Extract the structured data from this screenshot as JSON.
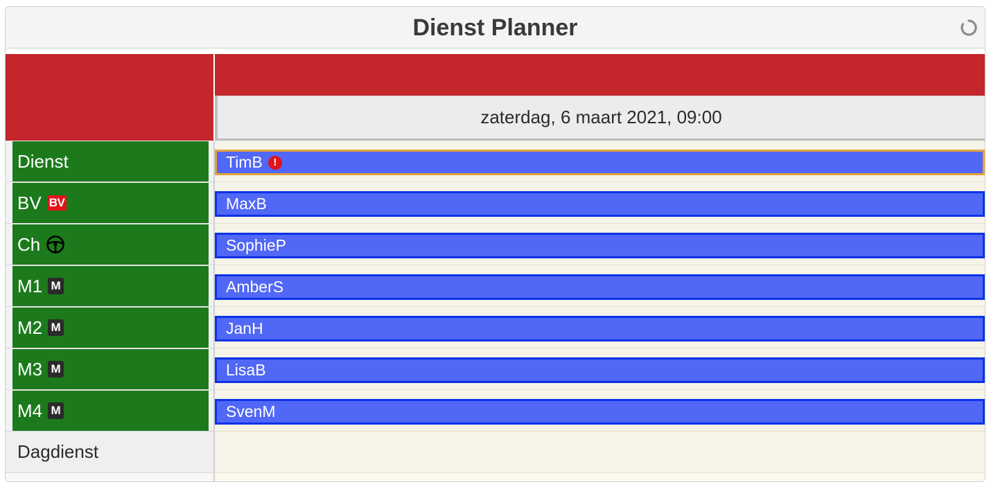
{
  "app": {
    "title": "Dienst Planner",
    "refresh_icon": "refresh-icon"
  },
  "header": {
    "date": "zaterdag, 6 maart 2021, 09:00"
  },
  "rows": [
    {
      "label": "Dienst",
      "badge": "",
      "name": "TimB",
      "warning": true
    },
    {
      "label": "BV",
      "badge": "BV",
      "name": "MaxB",
      "warning": false
    },
    {
      "label": "Ch",
      "badge": "steering-wheel-icon",
      "name": "SophieP",
      "warning": false
    },
    {
      "label": "M1",
      "badge": "M",
      "name": "AmberS",
      "warning": false
    },
    {
      "label": "M2",
      "badge": "M",
      "name": "JanH",
      "warning": false
    },
    {
      "label": "M3",
      "badge": "M",
      "name": "LisaB",
      "warning": false
    },
    {
      "label": "M4",
      "badge": "M",
      "name": "SvenM",
      "warning": false
    }
  ],
  "footer_row": {
    "label": "Dagdienst"
  },
  "colors": {
    "header_red": "#c3262b",
    "row_green": "#1c7a1c",
    "bar_blue": "#5167f5",
    "bar_border": "#0b33e6",
    "warning_border": "#e3a23a",
    "alert_red": "#e1131b"
  }
}
